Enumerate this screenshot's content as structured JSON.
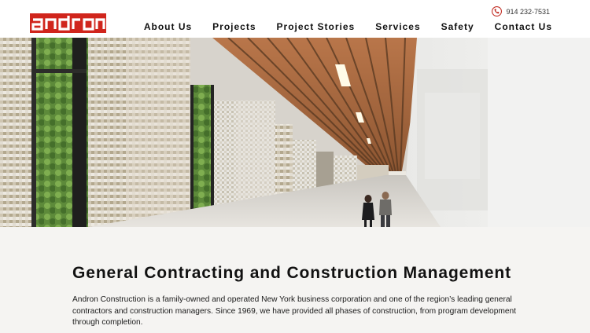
{
  "brand": {
    "name": "andron",
    "accent_color": "#d0251c"
  },
  "header": {
    "phone": {
      "icon": "phone-icon",
      "number": "914 232-7531"
    },
    "nav": [
      {
        "label": "About Us"
      },
      {
        "label": "Projects"
      },
      {
        "label": "Project Stories"
      },
      {
        "label": "Services"
      },
      {
        "label": "Safety"
      },
      {
        "label": "Contact Us"
      }
    ]
  },
  "hero": {
    "slide_count": 8,
    "active_slide": 0
  },
  "main": {
    "heading": "General Contracting and Construction Management",
    "intro": "Andron Construction is a family-owned and operated New York business corporation and one of the region’s leading general contractors and construction managers. Since 1969, we have provided all phases of construction, from program development through completion."
  }
}
